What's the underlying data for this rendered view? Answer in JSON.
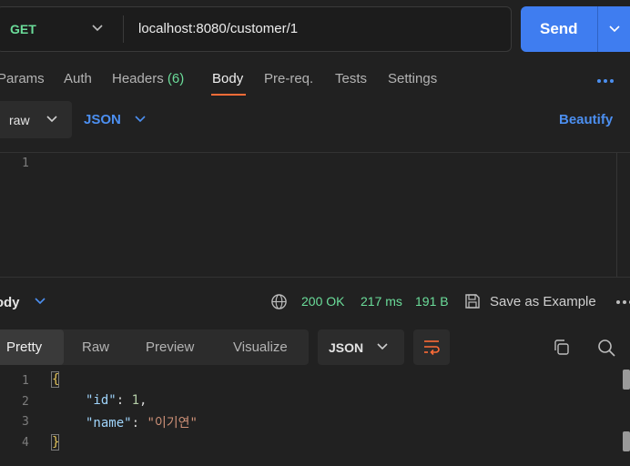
{
  "request": {
    "method": "GET",
    "url": "localhost:8080/customer/1",
    "send_label": "Send"
  },
  "tabs": {
    "params": "Params",
    "auth": "Auth",
    "headers": "Headers",
    "headers_count": "(6)",
    "body": "Body",
    "prereq": "Pre-req.",
    "tests": "Tests",
    "settings": "Settings"
  },
  "body_options": {
    "mode": "raw",
    "language": "JSON",
    "beautify": "Beautify",
    "line_numbers": [
      "1"
    ]
  },
  "response": {
    "label": "Body",
    "status": "200 OK",
    "time": "217 ms",
    "size": "191 B",
    "save_label": "Save as Example",
    "view_tabs": [
      "Pretty",
      "Raw",
      "Preview",
      "Visualize"
    ],
    "format": "JSON",
    "line_numbers": [
      "1",
      "2",
      "3",
      "4"
    ],
    "code": {
      "open_brace": "{",
      "key1": "\"id\"",
      "val1": "1",
      "key2": "\"name\"",
      "val2": "\"이기연\"",
      "close_brace": "}"
    }
  },
  "icons": [
    "chevron-down-icon",
    "more-icon",
    "globe-icon",
    "save-icon",
    "wrap-icon",
    "copy-icon",
    "search-icon"
  ],
  "colors": {
    "accent": "#ff6c37",
    "send": "#3f7df0",
    "success": "#6bdd9a",
    "link": "#4c8ff0"
  }
}
